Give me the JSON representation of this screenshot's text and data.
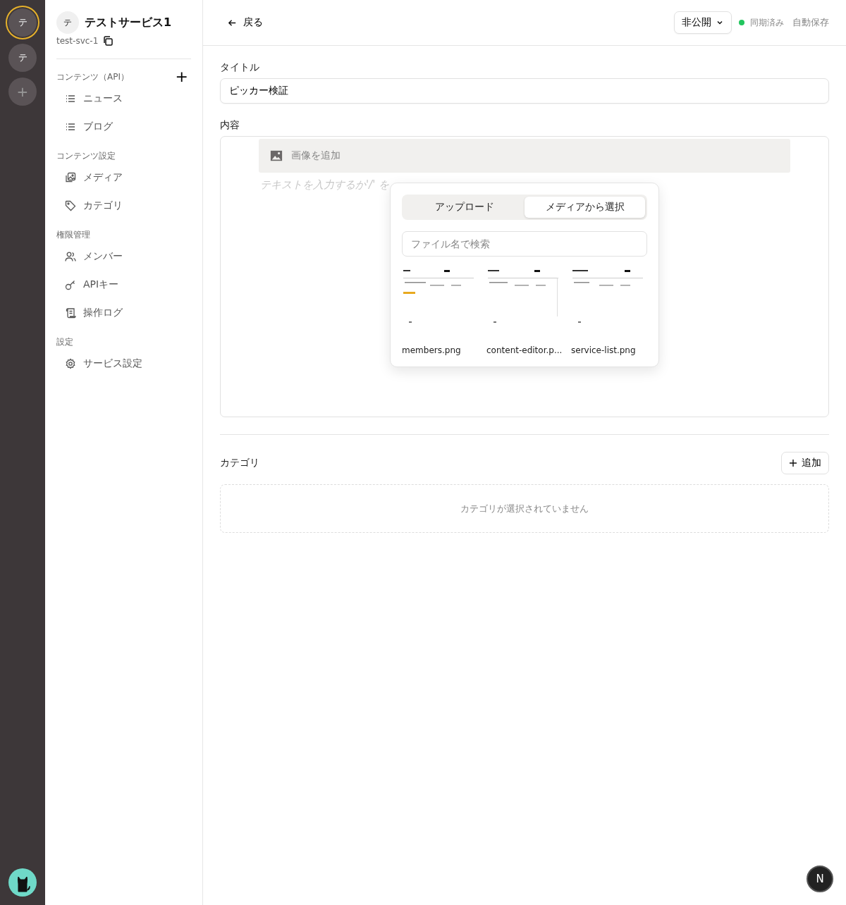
{
  "rail": {
    "services": [
      {
        "label": "テ",
        "selected": true
      },
      {
        "label": "テ",
        "selected": false
      }
    ],
    "add": "+"
  },
  "sidebar": {
    "avatar": "テ",
    "title": "テストサービス1",
    "slug": "test-svc-1",
    "sections": [
      {
        "heading": "コンテンツ（API）",
        "add": "+",
        "items": [
          {
            "label": "ニュース",
            "kind": "list"
          },
          {
            "label": "ブログ",
            "kind": "list"
          }
        ]
      },
      {
        "heading": "コンテンツ設定",
        "items": [
          {
            "label": "メディア",
            "kind": "media"
          },
          {
            "label": "カテゴリ",
            "kind": "tag"
          }
        ]
      },
      {
        "heading": "権限管理",
        "items": [
          {
            "label": "メンバー",
            "kind": "members"
          },
          {
            "label": "APIキー",
            "kind": "key"
          },
          {
            "label": "操作ログ",
            "kind": "log"
          }
        ]
      },
      {
        "heading": "設定",
        "items": [
          {
            "label": "サービス設定",
            "kind": "gear"
          }
        ]
      }
    ]
  },
  "topbar": {
    "back": "戻る",
    "visibility": "非公開",
    "sync": {
      "label": "同期済み",
      "color": "#22c55e"
    },
    "autosave": "自動保存"
  },
  "title_field": {
    "label": "タイトル",
    "value": "ピッカー検証"
  },
  "content": {
    "label": "内容",
    "image_block": "画像を追加",
    "placeholder": "テキストを入力するか'/' を",
    "picker": {
      "tabs": [
        {
          "label": "アップロード",
          "selected": false
        },
        {
          "label": "メディアから選択",
          "selected": true
        }
      ],
      "search": {
        "placeholder": "ファイル名で検索"
      },
      "files": [
        {
          "name": "members.png",
          "kind": "picture"
        },
        {
          "name": "content-editor.p...",
          "kind": "picture"
        },
        {
          "name": "service-list.png",
          "kind": "picture"
        }
      ]
    }
  },
  "categories": {
    "label": "カテゴリ",
    "add": "追加",
    "empty": "カテゴリが選択されていません"
  },
  "dev_badge": "N"
}
